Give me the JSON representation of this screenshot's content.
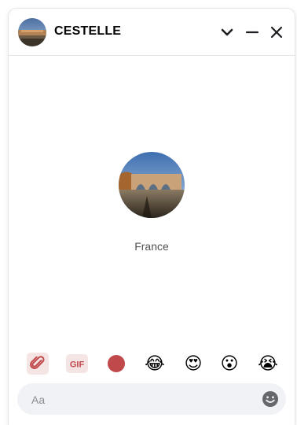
{
  "header": {
    "contact_name": "CESTELLE",
    "icons": [
      "chevron-down-icon",
      "minimize-icon",
      "close-icon"
    ]
  },
  "profile": {
    "location": "France"
  },
  "toolbar": {
    "gif_label": "GIF",
    "emojis": [
      "😂",
      "😍",
      "😮",
      "😭"
    ],
    "icons": [
      "paperclip-icon",
      "gif-icon",
      "record-icon"
    ]
  },
  "composer": {
    "placeholder": "Aa",
    "value": ""
  },
  "colors": {
    "accent_red": "#c0494b",
    "gif_bg": "#f5e4e4",
    "composer_bg": "#f0f2f5"
  }
}
